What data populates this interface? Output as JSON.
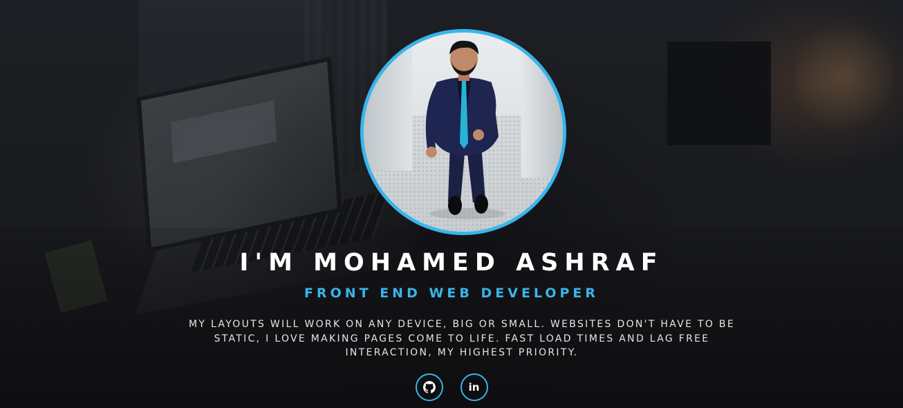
{
  "hero": {
    "headline": "I'M MOHAMED ASHRAF",
    "subtitle": "FRONT END WEB DEVELOPER",
    "description": "MY LAYOUTS WILL WORK ON ANY DEVICE, BIG OR SMALL. WEBSITES DON'T HAVE TO BE STATIC, I LOVE MAKING PAGES COME TO LIFE. FAST LOAD TIMES AND LAG FREE INTERACTION, MY HIGHEST PRIORITY."
  },
  "socials": [
    {
      "icon": "github-icon",
      "glyph": ""
    },
    {
      "icon": "linkedin-icon",
      "glyph": "in"
    }
  ],
  "colors": {
    "accent": "#3ab5ea",
    "headline": "#ffffff",
    "description": "#e6e6e6",
    "background": "#1c1c1f"
  }
}
